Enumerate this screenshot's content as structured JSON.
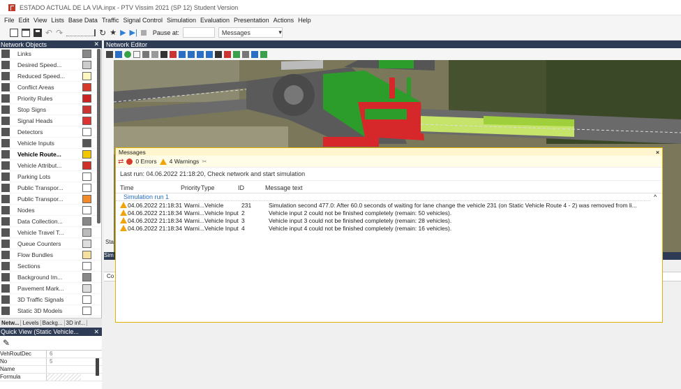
{
  "app": {
    "title": "ESTADO ACTUAL DE LA VIA.inpx - PTV Vissim 2021 (SP 12) Student Version"
  },
  "menu": [
    "File",
    "Edit",
    "View",
    "Lists",
    "Base Data",
    "Traffic",
    "Signal Control",
    "Simulation",
    "Evaluation",
    "Presentation",
    "Actions",
    "Help"
  ],
  "toolbar": {
    "pause_label": "Pause at:",
    "messages_combo": "Messages"
  },
  "network_objects": {
    "header": "Network Objects",
    "items": [
      {
        "label": "Links",
        "color": "#888888"
      },
      {
        "label": "Desired Speed...",
        "color": "#cccccc"
      },
      {
        "label": "Reduced Speed...",
        "color": "#fff6c0"
      },
      {
        "label": "Conflict Areas",
        "color": "#d63a2a"
      },
      {
        "label": "Priority Rules",
        "color": "#cc2222"
      },
      {
        "label": "Stop Signs",
        "color": "#cc3333"
      },
      {
        "label": "Signal Heads",
        "color": "#dd3333"
      },
      {
        "label": "Detectors",
        "color": "#ffffff"
      },
      {
        "label": "Vehicle Inputs",
        "color": "#555555"
      },
      {
        "label": "Vehicle Route...",
        "color": "#f2c700"
      },
      {
        "label": "Vehicle Attribut...",
        "color": "#d0302a"
      },
      {
        "label": "Parking Lots",
        "color": "#ffffff"
      },
      {
        "label": "Public Transpor...",
        "color": "#ffffff"
      },
      {
        "label": "Public Transpor...",
        "color": "#f28a2a"
      },
      {
        "label": "Nodes",
        "color": "#ffffff"
      },
      {
        "label": "Data Collection...",
        "color": "#888888"
      },
      {
        "label": "Vehicle Travel T...",
        "color": "#bbbbbb"
      },
      {
        "label": "Queue Counters",
        "color": "#dddddd"
      },
      {
        "label": "Flow Bundles",
        "color": "#f6e0a0"
      },
      {
        "label": "Sections",
        "color": "#ffffff"
      },
      {
        "label": "Background Im...",
        "color": "#888888"
      },
      {
        "label": "Pavement Mark...",
        "color": "#dddddd"
      },
      {
        "label": "3D Traffic Signals",
        "color": "#ffffff"
      },
      {
        "label": "Static 3D Models",
        "color": "#ffffff"
      }
    ],
    "selected_index": 9
  },
  "left_tabs": [
    "Netw...",
    "Levels",
    "Backg...",
    "3D inf..."
  ],
  "quick_view": {
    "header": "Quick View (Static Vehicle...",
    "rows": [
      {
        "k": "VehRoutDec",
        "v": "6"
      },
      {
        "k": "No",
        "v": "5"
      },
      {
        "k": "Name",
        "v": ""
      },
      {
        "k": "Formula",
        "v": ""
      }
    ]
  },
  "network_editor": {
    "header": "Network Editor"
  },
  "behind": {
    "sta": "Sta",
    "sim": "Sim",
    "co": "Co"
  },
  "messages": {
    "header": "Messages",
    "errors": "0 Errors",
    "warnings": "4 Warnings",
    "last_run": "Last run: 04.06.2022 21:18:20, Check network and start simulation",
    "columns": [
      "Time",
      "Priority",
      "Type",
      "ID",
      "Message text"
    ],
    "group": "Simulation run 1",
    "rows": [
      {
        "time": "04.06.2022 21:18:31",
        "priority": "Warni...",
        "type": "Vehicle",
        "id": "231",
        "text": "Simulation second 477.0: After 60.0 seconds of waiting for lane change the vehicle 231 (on Static Vehicle Route 4 - 2) was removed from li..."
      },
      {
        "time": "04.06.2022 21:18:34",
        "priority": "Warni...",
        "type": "Vehicle Input",
        "id": "2",
        "text": "Vehicle input 2 could not be finished completely  (remain: 50 vehicles)."
      },
      {
        "time": "04.06.2022 21:18:34",
        "priority": "Warni...",
        "type": "Vehicle Input",
        "id": "3",
        "text": "Vehicle input 3 could not be finished completely  (remain: 28 vehicles)."
      },
      {
        "time": "04.06.2022 21:18:34",
        "priority": "Warni...",
        "type": "Vehicle Input",
        "id": "4",
        "text": "Vehicle input 4 could not be finished completely  (remain: 16 vehicles)."
      }
    ]
  }
}
